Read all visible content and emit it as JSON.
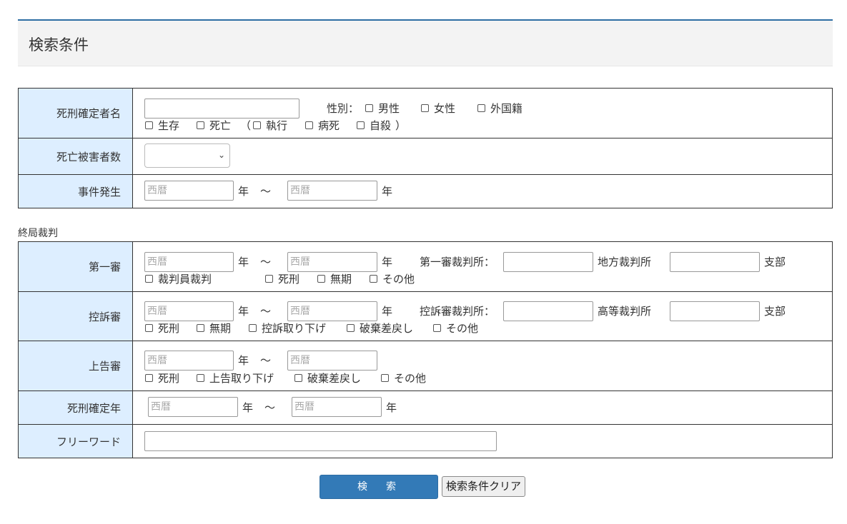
{
  "header": {
    "title": "検索条件"
  },
  "table1": {
    "row_condemned": {
      "label": "死刑確定者名",
      "sex_label": "性別：",
      "sex_options": [
        "男性",
        "女性",
        "外国籍"
      ],
      "status_alive": "生存",
      "status_dead": "死亡",
      "paren_open": "（",
      "executed": "執行",
      "disease": "病死",
      "suicide": "自殺",
      "paren_close": "）"
    },
    "row_victims": {
      "label": "死亡被害者数",
      "value": ""
    },
    "row_incident": {
      "label": "事件発生",
      "placeholder": "西暦",
      "year": "年",
      "tilde": "～"
    }
  },
  "final_label": "終局裁判",
  "table2": {
    "first": {
      "label": "第一審",
      "placeholder": "西暦",
      "year": "年",
      "tilde": "～",
      "court_label": "第一審裁判所：",
      "court_suffix": "地方裁判所",
      "branch": "支部",
      "options": [
        "裁判員裁判",
        "死刑",
        "無期",
        "その他"
      ]
    },
    "appeal": {
      "label": "控訴審",
      "placeholder": "西暦",
      "year": "年",
      "tilde": "～",
      "court_label": "控訴審裁判所：",
      "court_suffix": "高等裁判所",
      "branch": "支部",
      "options": [
        "死刑",
        "無期",
        "控訴取り下げ",
        "破棄差戻し",
        "その他"
      ]
    },
    "final_appeal": {
      "label": "上告審",
      "placeholder": "西暦",
      "year": "年",
      "tilde": "～",
      "options": [
        "死刑",
        "上告取り下げ",
        "破棄差戻し",
        "その他"
      ]
    },
    "confirm_year": {
      "label": "死刑確定年",
      "placeholder": "西暦",
      "year": "年",
      "tilde": "～"
    },
    "freeword": {
      "label": "フリーワード",
      "value": ""
    }
  },
  "buttons": {
    "search": "検　索",
    "clear": "検索条件クリア"
  },
  "colors": {
    "label_bg": "#ddeeff",
    "accent": "#337ab7",
    "border": "#333333"
  }
}
